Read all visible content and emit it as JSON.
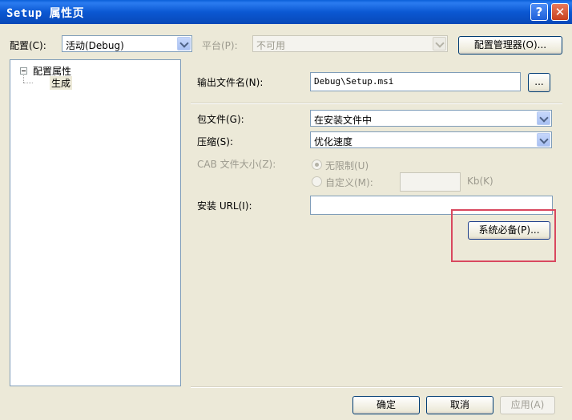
{
  "window": {
    "title": "Setup 属性页",
    "help_glyph": "?",
    "close_glyph": "✕"
  },
  "toolbar": {
    "config_label": "配置(C):",
    "config_value": "活动(Debug)",
    "platform_label": "平台(P):",
    "platform_value": "不可用",
    "config_manager_button": "配置管理器(O)..."
  },
  "tree": {
    "root_label": "配置属性",
    "child_label": "生成"
  },
  "form": {
    "output_label": "输出文件名(N):",
    "output_value": "Debug\\Setup.msi",
    "browse_button": "...",
    "package_label": "包文件(G):",
    "package_value": "在安装文件中",
    "compress_label": "压缩(S):",
    "compress_value": "优化速度",
    "cab_label": "CAB 文件大小(Z):",
    "unlimited_label": "无限制(U)",
    "custom_label": "自定义(M):",
    "cab_unit": "Kb(K)",
    "install_url_label": "安装 URL(I):",
    "install_url_value": "",
    "prereq_button": "系统必备(P)..."
  },
  "footer": {
    "ok_button": "确定",
    "cancel_button": "取消",
    "apply_button": "应用(A)"
  },
  "colors": {
    "highlight_border": "#d9485f",
    "titlebar": "#0b58d3"
  }
}
